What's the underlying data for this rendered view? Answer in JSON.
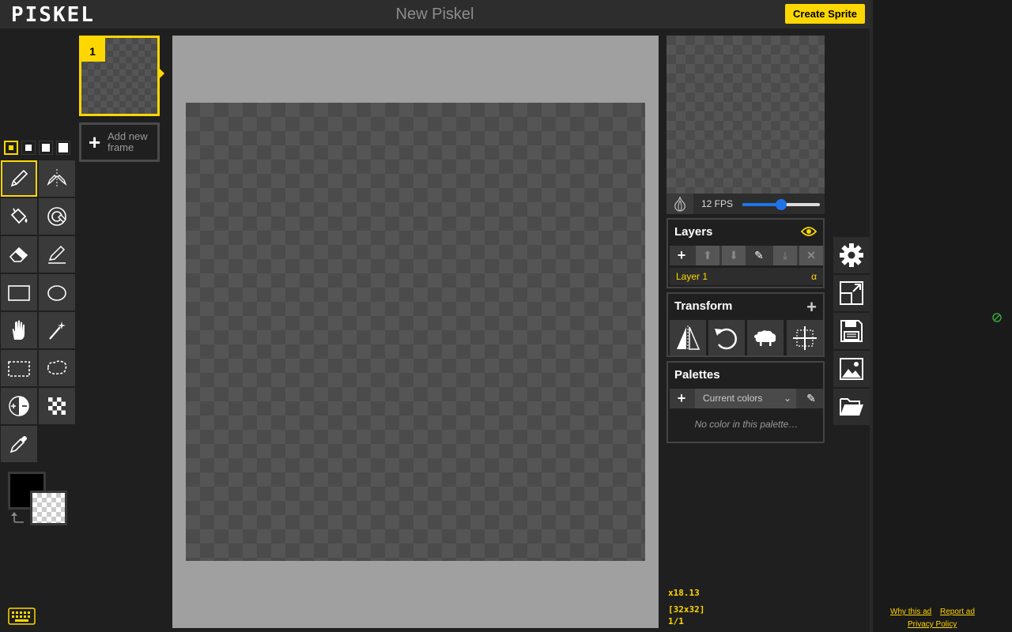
{
  "header": {
    "logo": "PISKEL",
    "title": "New Piskel",
    "create_sprite": "Create Sprite"
  },
  "frames": {
    "items": [
      {
        "index": "1"
      }
    ],
    "add_frame_label": "Add new frame"
  },
  "preview": {
    "fps_label": "12 FPS",
    "fps_value": 12,
    "fps_max": 24
  },
  "layers": {
    "title": "Layers",
    "items": [
      {
        "name": "Layer 1",
        "alpha_label": "α"
      }
    ]
  },
  "transform": {
    "title": "Transform"
  },
  "palettes": {
    "title": "Palettes",
    "selected": "Current colors",
    "empty_text": "No color in this palette…"
  },
  "status": {
    "cursor": "x18.13",
    "size": "[32x32]",
    "frame": "1/1"
  },
  "ad": {
    "why": "Why this ad",
    "report": "Report ad",
    "privacy": "Privacy Policy"
  },
  "colors": {
    "accent": "#ffd700",
    "primary": "#000000",
    "background": "#1f1f1f"
  }
}
